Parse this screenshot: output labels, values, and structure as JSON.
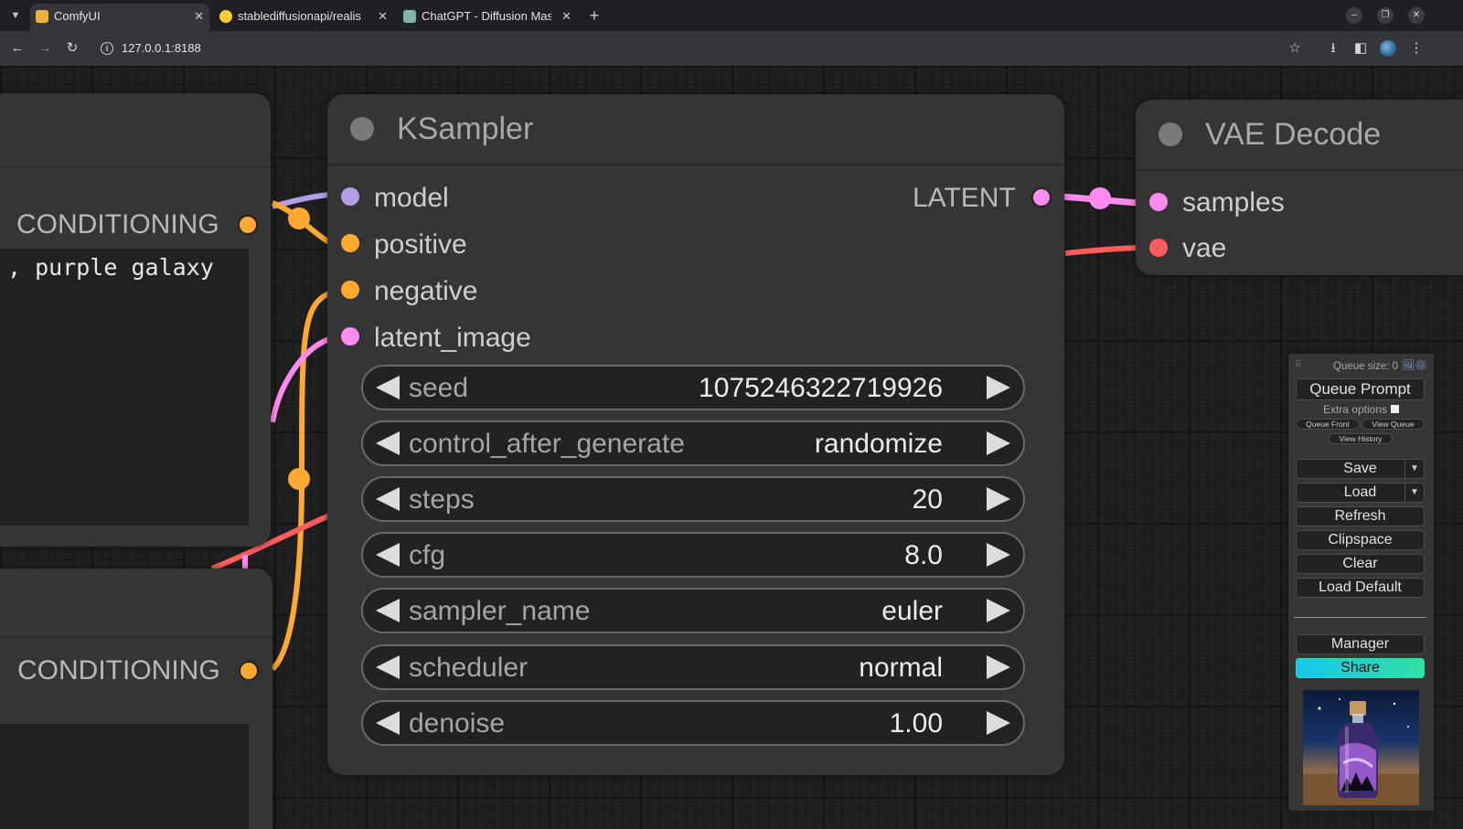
{
  "browser": {
    "tabs": [
      {
        "title": "ComfyUI",
        "active": true
      },
      {
        "title": "stablediffusionapi/realis",
        "active": false
      },
      {
        "title": "ChatGPT - Diffusion Mas",
        "active": false
      }
    ],
    "url": "127.0.0.1:8188"
  },
  "left_nodes": {
    "top_output": "CONDITIONING",
    "top_text": ", purple galaxy",
    "bottom_output": "CONDITIONING"
  },
  "ksampler": {
    "title": "KSampler",
    "inputs": [
      {
        "name": "model",
        "color": "#b49ee6"
      },
      {
        "name": "positive",
        "color": "#ffa832"
      },
      {
        "name": "negative",
        "color": "#ffa832"
      },
      {
        "name": "latent_image",
        "color": "#ff8af0"
      }
    ],
    "output": {
      "name": "LATENT",
      "color": "#ff8af0"
    },
    "widgets": [
      {
        "name": "seed",
        "value": "1075246322719926"
      },
      {
        "name": "control_after_generate",
        "value": "randomize"
      },
      {
        "name": "steps",
        "value": "20"
      },
      {
        "name": "cfg",
        "value": "8.0"
      },
      {
        "name": "sampler_name",
        "value": "euler"
      },
      {
        "name": "scheduler",
        "value": "normal"
      },
      {
        "name": "denoise",
        "value": "1.00"
      }
    ]
  },
  "vae_decode": {
    "title": "VAE Decode",
    "inputs": [
      {
        "name": "samples",
        "color": "#ff8af0"
      },
      {
        "name": "vae",
        "color": "#ff5c5c"
      }
    ]
  },
  "menu": {
    "queue_size": "Queue size: 0",
    "queue_prompt": "Queue Prompt",
    "extra_options": "Extra options",
    "queue_front": "Queue Front",
    "view_queue": "View Queue",
    "view_history": "View History",
    "save": "Save",
    "load": "Load",
    "refresh": "Refresh",
    "clipspace": "Clipspace",
    "clear": "Clear",
    "load_default": "Load Default",
    "manager": "Manager",
    "share": "Share",
    "share_gradient": [
      "#17c6ee",
      "#2fe0a4"
    ]
  }
}
